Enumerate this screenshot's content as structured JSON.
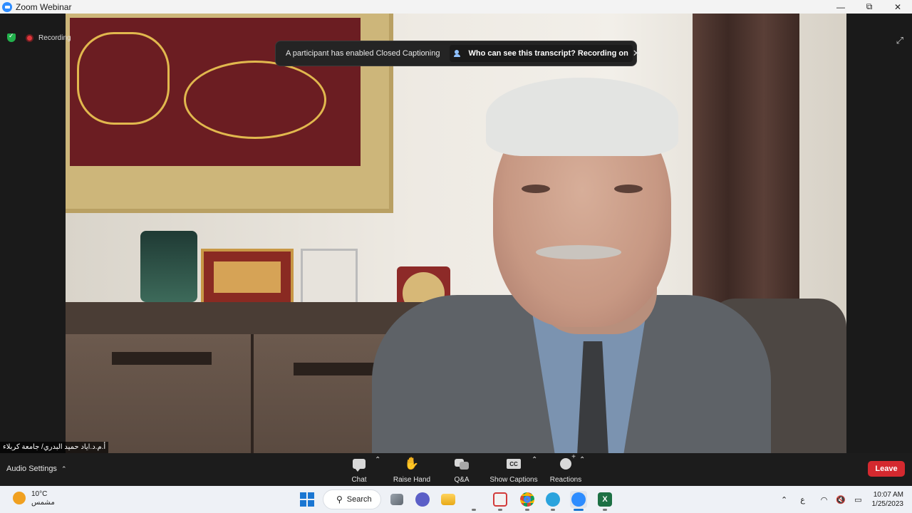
{
  "window": {
    "title": "Zoom Webinar",
    "controls": [
      "—",
      "⧉",
      "✕"
    ]
  },
  "recording": {
    "label": "Recording"
  },
  "notification": {
    "message": "A participant has enabled Closed Captioning",
    "link": "Who can see this transcript? Recording on",
    "close": "✕"
  },
  "expand": "⤢",
  "speaker": {
    "name": "أ.م.د.اياد حميد البدري/ جامعة كربلاء"
  },
  "toolbar": {
    "audio_settings": "Audio Settings",
    "caret": "⌃",
    "items": [
      {
        "label": "Chat",
        "icon": "chat-icon",
        "has_caret": true
      },
      {
        "label": "Raise Hand",
        "icon": "hand-icon",
        "has_caret": false
      },
      {
        "label": "Q&A",
        "icon": "qa-icon",
        "has_caret": false
      },
      {
        "label": "Show Captions",
        "icon": "cc-icon",
        "has_caret": true
      },
      {
        "label": "Reactions",
        "icon": "reactions-icon",
        "has_caret": true
      }
    ],
    "cc_text": "CC",
    "leave": "Leave",
    "leave_color": "#d4292f"
  },
  "taskbar": {
    "weather_temp": "10°C",
    "weather_cond": "مشمس",
    "search": "Search",
    "apps": [
      "widgets",
      "explorer",
      "snipping",
      "chrome",
      "telegram",
      "zoom",
      "excel"
    ],
    "tray": {
      "chevron": "⌃",
      "lang": "ع",
      "wifi": "wifi-icon",
      "volume": "🔇",
      "battery": "battery-icon"
    },
    "time": "10:07 AM",
    "date": "1/25/2023"
  }
}
